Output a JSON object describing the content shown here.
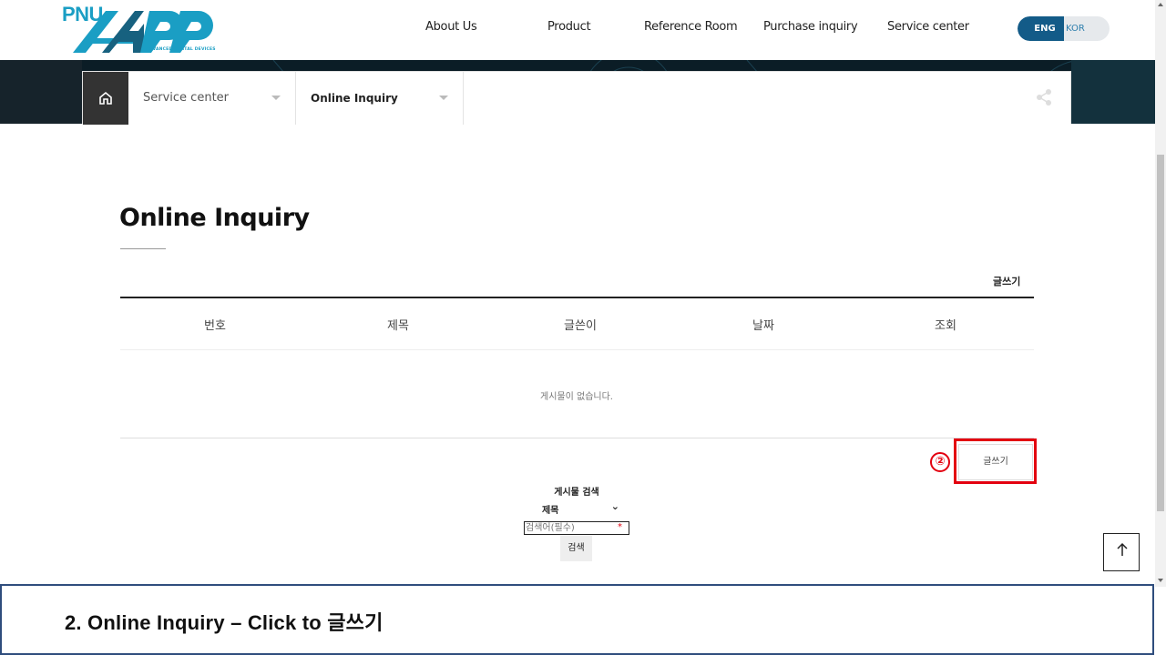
{
  "header": {
    "logo_text": "PNU APD",
    "logo_subtitle": "ADVANCED DENTAL DEVICES",
    "nav": [
      {
        "label": "About Us"
      },
      {
        "label": "Product"
      },
      {
        "label": "Reference Room"
      },
      {
        "label": "Purchase inquiry"
      },
      {
        "label": "Service center"
      }
    ],
    "lang": {
      "active": "ENG",
      "other": "KOR"
    }
  },
  "breadcrumb": {
    "home_icon": "home-icon",
    "level1": "Service center",
    "level2": "Online Inquiry",
    "share_icon": "share-icon"
  },
  "main": {
    "title": "Online Inquiry",
    "write_link": "글쓰기",
    "table": {
      "headers": [
        "번호",
        "제목",
        "글쓴이",
        "날짜",
        "조회"
      ],
      "empty_message": "게시물이 없습니다."
    },
    "write_button": "글쓰기"
  },
  "search": {
    "title": "게시물 검색",
    "field_selected": "제목",
    "placeholder": "검색어(필수)",
    "required_mark": "*",
    "button": "검색"
  },
  "annotation": {
    "step_marker": "②",
    "caption": "2. Online Inquiry – Click to 글쓰기",
    "highlight_color": "#e3000f"
  },
  "colors": {
    "brand_blue": "#135b88",
    "logo_cyan": "#1a9ec4",
    "hero_dark": "#0b1d26"
  }
}
